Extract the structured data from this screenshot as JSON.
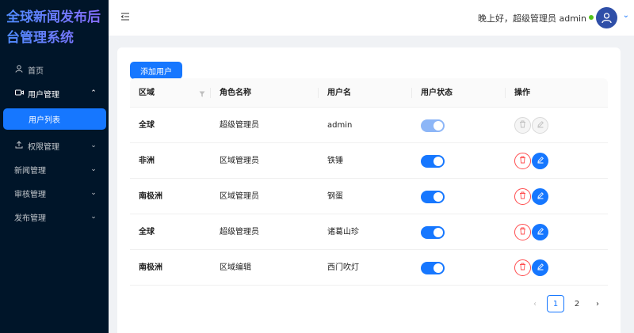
{
  "app": {
    "title": "全球新闻发布后台管理系统"
  },
  "sidebar": {
    "items": [
      {
        "label": "首页",
        "icon": "user-icon"
      },
      {
        "label": "用户管理",
        "icon": "video-icon",
        "arrow": "⌃"
      },
      {
        "label": "用户列表"
      },
      {
        "label": "权限管理",
        "icon": "upload-icon",
        "arrow": "⌄"
      },
      {
        "label": "新闻管理",
        "arrow": "⌄"
      },
      {
        "label": "审核管理",
        "arrow": "⌄"
      },
      {
        "label": "发布管理",
        "arrow": "⌄"
      }
    ]
  },
  "header": {
    "greeting": "晚上好，超级管理员 admin",
    "caret": "⌄"
  },
  "toolbar": {
    "add_label": "添加用户"
  },
  "table": {
    "columns": [
      "区域",
      "角色名称",
      "用户名",
      "用户状态",
      "操作"
    ],
    "rows": [
      {
        "region": "全球",
        "role": "超级管理员",
        "username": "admin",
        "status_on": true,
        "actions_disabled": true
      },
      {
        "region": "非洲",
        "role": "区域管理员",
        "username": "铁锤",
        "status_on": true,
        "actions_disabled": false
      },
      {
        "region": "南极洲",
        "role": "区域管理员",
        "username": "钢蛋",
        "status_on": true,
        "actions_disabled": false
      },
      {
        "region": "全球",
        "role": "超级管理员",
        "username": "诸葛山珍",
        "status_on": true,
        "actions_disabled": false
      },
      {
        "region": "南极洲",
        "role": "区域编辑",
        "username": "西门吹灯",
        "status_on": true,
        "actions_disabled": false
      }
    ]
  },
  "pagination": {
    "prev": "‹",
    "pages": [
      "1",
      "2"
    ],
    "current": "1",
    "next": "›"
  },
  "colors": {
    "primary": "#1677ff",
    "danger": "#ff4d4f",
    "sider": "#001529",
    "online": "#52c41a"
  }
}
